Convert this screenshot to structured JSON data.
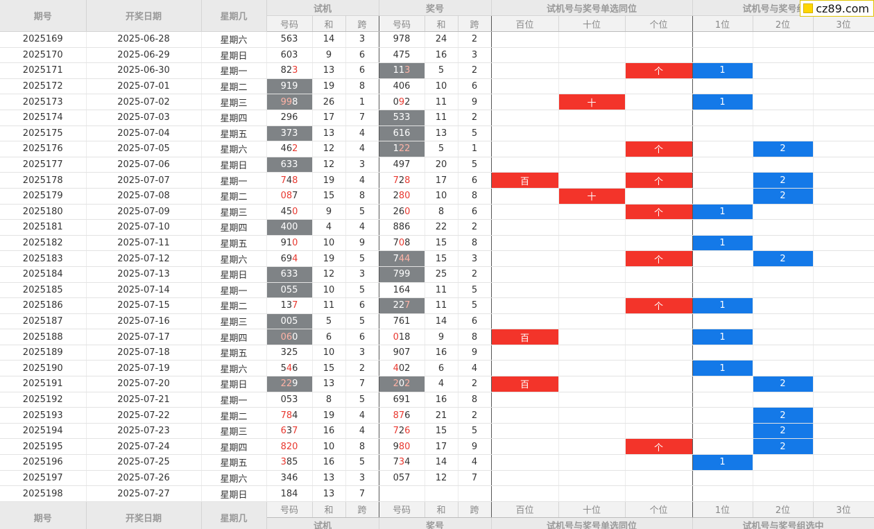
{
  "header": {
    "col_issue": "期号",
    "col_date": "开奖日期",
    "col_weekday": "星期几",
    "grp_trial": "试机",
    "grp_prize": "奖号",
    "grp_pos": "试机号与奖号单选同位",
    "grp_combo": "试机号与奖号组选中",
    "sub_num": "号码",
    "sub_sum": "和",
    "sub_span": "跨",
    "sub_hundreds": "百位",
    "sub_tens": "十位",
    "sub_units": "个位",
    "sub_1": "1位",
    "sub_2": "2位",
    "sub_3": "3位"
  },
  "logo": {
    "text": "cz89.com",
    "color": "#ffd600"
  },
  "colors": {
    "mark_red": "#f3342a",
    "mark_blue": "#1479e8",
    "box_gray": "#7f8386",
    "hit_red": "#e8382f"
  },
  "rows": [
    {
      "issue": "2025169",
      "date": "2025-06-28",
      "wd": "星期六",
      "t": "563",
      "thit": [],
      "tbox": false,
      "ts": "14",
      "tsp": "3",
      "p": "978",
      "phit": [],
      "pbox": false,
      "ps": "24",
      "psp": "2",
      "pos": [
        "",
        "",
        ""
      ],
      "combo": [
        "",
        "",
        ""
      ]
    },
    {
      "issue": "2025170",
      "date": "2025-06-29",
      "wd": "星期日",
      "t": "603",
      "thit": [],
      "tbox": false,
      "ts": "9",
      "tsp": "6",
      "p": "475",
      "phit": [],
      "pbox": false,
      "ps": "16",
      "psp": "3",
      "pos": [
        "",
        "",
        ""
      ],
      "combo": [
        "",
        "",
        ""
      ]
    },
    {
      "issue": "2025171",
      "date": "2025-06-30",
      "wd": "星期一",
      "t": "823",
      "thit": [
        2
      ],
      "tbox": false,
      "ts": "13",
      "tsp": "6",
      "p": "113",
      "phit": [
        2
      ],
      "pbox": true,
      "ps": "5",
      "psp": "2",
      "pos": [
        "",
        "",
        "个"
      ],
      "combo": [
        "1",
        "",
        ""
      ]
    },
    {
      "issue": "2025172",
      "date": "2025-07-01",
      "wd": "星期二",
      "t": "919",
      "thit": [],
      "tbox": true,
      "ts": "19",
      "tsp": "8",
      "p": "406",
      "phit": [],
      "pbox": false,
      "ps": "10",
      "psp": "6",
      "pos": [
        "",
        "",
        ""
      ],
      "combo": [
        "",
        "",
        ""
      ]
    },
    {
      "issue": "2025173",
      "date": "2025-07-02",
      "wd": "星期三",
      "t": "998",
      "thit": [
        0,
        1
      ],
      "tbox": true,
      "ts": "26",
      "tsp": "1",
      "p": "092",
      "phit": [
        1
      ],
      "pbox": false,
      "ps": "11",
      "psp": "9",
      "pos": [
        "",
        "十",
        ""
      ],
      "combo": [
        "1",
        "",
        ""
      ]
    },
    {
      "issue": "2025174",
      "date": "2025-07-03",
      "wd": "星期四",
      "t": "296",
      "thit": [],
      "tbox": false,
      "ts": "17",
      "tsp": "7",
      "p": "533",
      "phit": [],
      "pbox": true,
      "ps": "11",
      "psp": "2",
      "pos": [
        "",
        "",
        ""
      ],
      "combo": [
        "",
        "",
        ""
      ]
    },
    {
      "issue": "2025175",
      "date": "2025-07-04",
      "wd": "星期五",
      "t": "373",
      "thit": [],
      "tbox": true,
      "ts": "13",
      "tsp": "4",
      "p": "616",
      "phit": [],
      "pbox": true,
      "ps": "13",
      "psp": "5",
      "pos": [
        "",
        "",
        ""
      ],
      "combo": [
        "",
        "",
        ""
      ]
    },
    {
      "issue": "2025176",
      "date": "2025-07-05",
      "wd": "星期六",
      "t": "462",
      "thit": [
        2
      ],
      "tbox": false,
      "ts": "12",
      "tsp": "4",
      "p": "122",
      "phit": [
        1,
        2
      ],
      "pbox": true,
      "ps": "5",
      "psp": "1",
      "pos": [
        "",
        "",
        "个"
      ],
      "combo": [
        "",
        "2",
        ""
      ]
    },
    {
      "issue": "2025177",
      "date": "2025-07-06",
      "wd": "星期日",
      "t": "633",
      "thit": [],
      "tbox": true,
      "ts": "12",
      "tsp": "3",
      "p": "497",
      "phit": [],
      "pbox": false,
      "ps": "20",
      "psp": "5",
      "pos": [
        "",
        "",
        ""
      ],
      "combo": [
        "",
        "",
        ""
      ]
    },
    {
      "issue": "2025178",
      "date": "2025-07-07",
      "wd": "星期一",
      "t": "748",
      "thit": [
        0,
        2
      ],
      "tbox": false,
      "ts": "19",
      "tsp": "4",
      "p": "728",
      "phit": [
        0,
        2
      ],
      "pbox": false,
      "ps": "17",
      "psp": "6",
      "pos": [
        "百",
        "",
        "个"
      ],
      "combo": [
        "",
        "2",
        ""
      ]
    },
    {
      "issue": "2025179",
      "date": "2025-07-08",
      "wd": "星期二",
      "t": "087",
      "thit": [
        0,
        1
      ],
      "tbox": false,
      "ts": "15",
      "tsp": "8",
      "p": "280",
      "phit": [
        1,
        2
      ],
      "pbox": false,
      "ps": "10",
      "psp": "8",
      "pos": [
        "",
        "十",
        ""
      ],
      "combo": [
        "",
        "2",
        ""
      ]
    },
    {
      "issue": "2025180",
      "date": "2025-07-09",
      "wd": "星期三",
      "t": "450",
      "thit": [
        2
      ],
      "tbox": false,
      "ts": "9",
      "tsp": "5",
      "p": "260",
      "phit": [
        2
      ],
      "pbox": false,
      "ps": "8",
      "psp": "6",
      "pos": [
        "",
        "",
        "个"
      ],
      "combo": [
        "1",
        "",
        ""
      ]
    },
    {
      "issue": "2025181",
      "date": "2025-07-10",
      "wd": "星期四",
      "t": "400",
      "thit": [],
      "tbox": true,
      "ts": "4",
      "tsp": "4",
      "p": "886",
      "phit": [],
      "pbox": false,
      "ps": "22",
      "psp": "2",
      "pos": [
        "",
        "",
        ""
      ],
      "combo": [
        "",
        "",
        ""
      ]
    },
    {
      "issue": "2025182",
      "date": "2025-07-11",
      "wd": "星期五",
      "t": "910",
      "thit": [
        2
      ],
      "tbox": false,
      "ts": "10",
      "tsp": "9",
      "p": "708",
      "phit": [
        1
      ],
      "pbox": false,
      "ps": "15",
      "psp": "8",
      "pos": [
        "",
        "",
        ""
      ],
      "combo": [
        "1",
        "",
        ""
      ]
    },
    {
      "issue": "2025183",
      "date": "2025-07-12",
      "wd": "星期六",
      "t": "694",
      "thit": [
        2
      ],
      "tbox": false,
      "ts": "19",
      "tsp": "5",
      "p": "744",
      "phit": [
        1,
        2
      ],
      "pbox": true,
      "ps": "15",
      "psp": "3",
      "pos": [
        "",
        "",
        "个"
      ],
      "combo": [
        "",
        "2",
        ""
      ]
    },
    {
      "issue": "2025184",
      "date": "2025-07-13",
      "wd": "星期日",
      "t": "633",
      "thit": [],
      "tbox": true,
      "ts": "12",
      "tsp": "3",
      "p": "799",
      "phit": [],
      "pbox": true,
      "ps": "25",
      "psp": "2",
      "pos": [
        "",
        "",
        ""
      ],
      "combo": [
        "",
        "",
        ""
      ]
    },
    {
      "issue": "2025185",
      "date": "2025-07-14",
      "wd": "星期一",
      "t": "055",
      "thit": [],
      "tbox": true,
      "ts": "10",
      "tsp": "5",
      "p": "164",
      "phit": [],
      "pbox": false,
      "ps": "11",
      "psp": "5",
      "pos": [
        "",
        "",
        ""
      ],
      "combo": [
        "",
        "",
        ""
      ]
    },
    {
      "issue": "2025186",
      "date": "2025-07-15",
      "wd": "星期二",
      "t": "137",
      "thit": [
        2
      ],
      "tbox": false,
      "ts": "11",
      "tsp": "6",
      "p": "227",
      "phit": [
        2
      ],
      "pbox": true,
      "ps": "11",
      "psp": "5",
      "pos": [
        "",
        "",
        "个"
      ],
      "combo": [
        "1",
        "",
        ""
      ]
    },
    {
      "issue": "2025187",
      "date": "2025-07-16",
      "wd": "星期三",
      "t": "005",
      "thit": [],
      "tbox": true,
      "ts": "5",
      "tsp": "5",
      "p": "761",
      "phit": [],
      "pbox": false,
      "ps": "14",
      "psp": "6",
      "pos": [
        "",
        "",
        ""
      ],
      "combo": [
        "",
        "",
        ""
      ]
    },
    {
      "issue": "2025188",
      "date": "2025-07-17",
      "wd": "星期四",
      "t": "060",
      "thit": [
        0,
        1
      ],
      "tbox": true,
      "ts": "6",
      "tsp": "6",
      "p": "018",
      "phit": [
        0
      ],
      "pbox": false,
      "ps": "9",
      "psp": "8",
      "pos": [
        "百",
        "",
        ""
      ],
      "combo": [
        "1",
        "",
        ""
      ]
    },
    {
      "issue": "2025189",
      "date": "2025-07-18",
      "wd": "星期五",
      "t": "325",
      "thit": [],
      "tbox": false,
      "ts": "10",
      "tsp": "3",
      "p": "907",
      "phit": [],
      "pbox": false,
      "ps": "16",
      "psp": "9",
      "pos": [
        "",
        "",
        ""
      ],
      "combo": [
        "",
        "",
        ""
      ]
    },
    {
      "issue": "2025190",
      "date": "2025-07-19",
      "wd": "星期六",
      "t": "546",
      "thit": [
        1
      ],
      "tbox": false,
      "ts": "15",
      "tsp": "2",
      "p": "402",
      "phit": [
        0
      ],
      "pbox": false,
      "ps": "6",
      "psp": "4",
      "pos": [
        "",
        "",
        ""
      ],
      "combo": [
        "1",
        "",
        ""
      ]
    },
    {
      "issue": "2025191",
      "date": "2025-07-20",
      "wd": "星期日",
      "t": "229",
      "thit": [
        0,
        1
      ],
      "tbox": true,
      "ts": "13",
      "tsp": "7",
      "p": "202",
      "phit": [
        0,
        2
      ],
      "pbox": true,
      "ps": "4",
      "psp": "2",
      "pos": [
        "百",
        "",
        ""
      ],
      "combo": [
        "",
        "2",
        ""
      ]
    },
    {
      "issue": "2025192",
      "date": "2025-07-21",
      "wd": "星期一",
      "t": "053",
      "thit": [],
      "tbox": false,
      "ts": "8",
      "tsp": "5",
      "p": "691",
      "phit": [],
      "pbox": false,
      "ps": "16",
      "psp": "8",
      "pos": [
        "",
        "",
        ""
      ],
      "combo": [
        "",
        "",
        ""
      ]
    },
    {
      "issue": "2025193",
      "date": "2025-07-22",
      "wd": "星期二",
      "t": "784",
      "thit": [
        0,
        1
      ],
      "tbox": false,
      "ts": "19",
      "tsp": "4",
      "p": "876",
      "phit": [
        0,
        1
      ],
      "pbox": false,
      "ps": "21",
      "psp": "2",
      "pos": [
        "",
        "",
        ""
      ],
      "combo": [
        "",
        "2",
        ""
      ]
    },
    {
      "issue": "2025194",
      "date": "2025-07-23",
      "wd": "星期三",
      "t": "637",
      "thit": [
        0,
        2
      ],
      "tbox": false,
      "ts": "16",
      "tsp": "4",
      "p": "726",
      "phit": [
        0,
        2
      ],
      "pbox": false,
      "ps": "15",
      "psp": "5",
      "pos": [
        "",
        "",
        ""
      ],
      "combo": [
        "",
        "2",
        ""
      ]
    },
    {
      "issue": "2025195",
      "date": "2025-07-24",
      "wd": "星期四",
      "t": "820",
      "thit": [
        0,
        1,
        2
      ],
      "tbox": false,
      "ts": "10",
      "tsp": "8",
      "p": "980",
      "phit": [
        1,
        2
      ],
      "pbox": false,
      "ps": "17",
      "psp": "9",
      "pos": [
        "",
        "",
        "个"
      ],
      "combo": [
        "",
        "2",
        ""
      ]
    },
    {
      "issue": "2025196",
      "date": "2025-07-25",
      "wd": "星期五",
      "t": "385",
      "thit": [
        0
      ],
      "tbox": false,
      "ts": "16",
      "tsp": "5",
      "p": "734",
      "phit": [
        1
      ],
      "pbox": false,
      "ps": "14",
      "psp": "4",
      "pos": [
        "",
        "",
        ""
      ],
      "combo": [
        "1",
        "",
        ""
      ]
    },
    {
      "issue": "2025197",
      "date": "2025-07-26",
      "wd": "星期六",
      "t": "346",
      "thit": [],
      "tbox": false,
      "ts": "13",
      "tsp": "3",
      "p": "057",
      "phit": [],
      "pbox": false,
      "ps": "12",
      "psp": "7",
      "pos": [
        "",
        "",
        ""
      ],
      "combo": [
        "",
        "",
        ""
      ]
    },
    {
      "issue": "2025198",
      "date": "2025-07-27",
      "wd": "星期日",
      "t": "184",
      "thit": [],
      "tbox": false,
      "ts": "13",
      "tsp": "7",
      "p": "",
      "phit": [],
      "pbox": false,
      "ps": "",
      "psp": "",
      "pos": [
        "",
        "",
        ""
      ],
      "combo": [
        "",
        "",
        ""
      ]
    }
  ]
}
